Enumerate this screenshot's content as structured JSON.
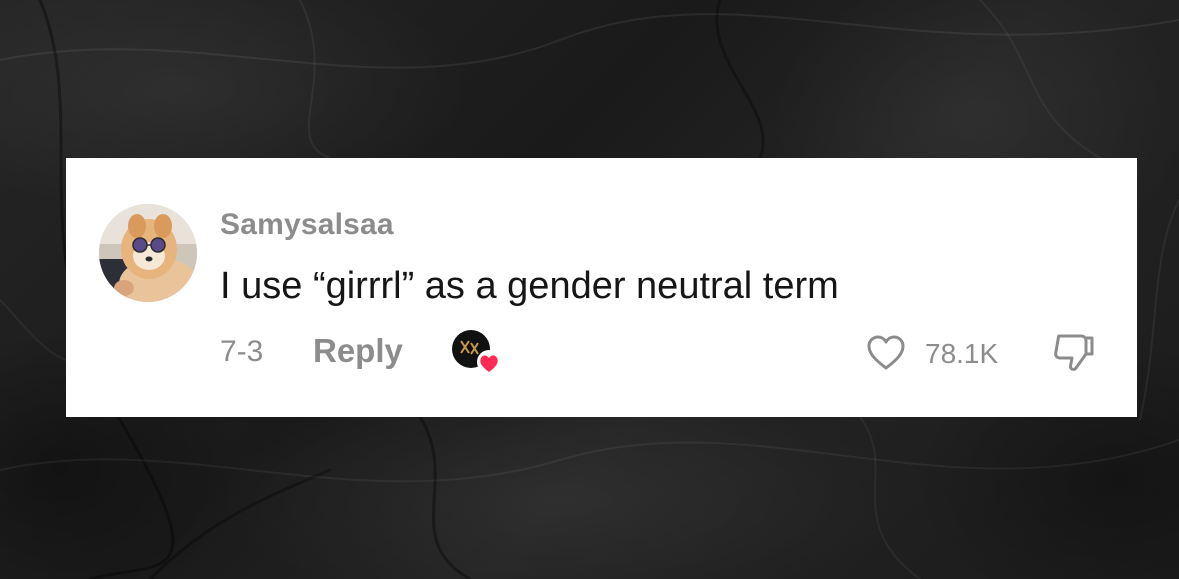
{
  "comment": {
    "username": "Samysalsaa",
    "text": "I use “girrrl” as a gender neutral term",
    "date": "7-3",
    "reply_label": "Reply",
    "like_count": "78.1K",
    "creator_liked": true
  },
  "icons": {
    "avatar": "user-avatar-dog-with-sunglasses",
    "liker": "creator-liked-avatar-icon",
    "like": "heart-outline-icon",
    "dislike": "thumbs-down-icon"
  },
  "colors": {
    "background": "#1f1f1f",
    "card": "#ffffff",
    "text_primary": "#161616",
    "text_secondary": "#8c8c8c",
    "heart_badge": "#fe2c55"
  }
}
